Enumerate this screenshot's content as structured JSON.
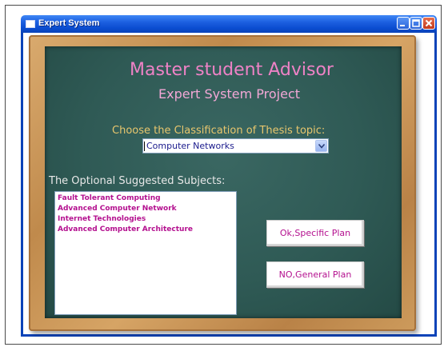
{
  "window": {
    "title": "Expert System"
  },
  "board": {
    "title": "Master student Advisor",
    "subtitle": "Expert System Project",
    "choose_label": "Choose the Classification of Thesis topic:",
    "selected_topic": "Computer Networks",
    "subjects_label": "The Optional Suggested Subjects:",
    "subjects": [
      "Fault Tolerant Computing",
      "Advanced Computer Network",
      "Internet Technologies",
      "Advanced Computer Architecture"
    ],
    "ok_button": "Ok,Specific Plan",
    "no_button": "NO,General Plan"
  },
  "colors": {
    "board": "#2f5a55",
    "title_pink": "#ee82c6",
    "label_yellow": "#e8c66d",
    "list_magenta": "#b4108f",
    "titlebar_blue": "#0b43b8"
  }
}
